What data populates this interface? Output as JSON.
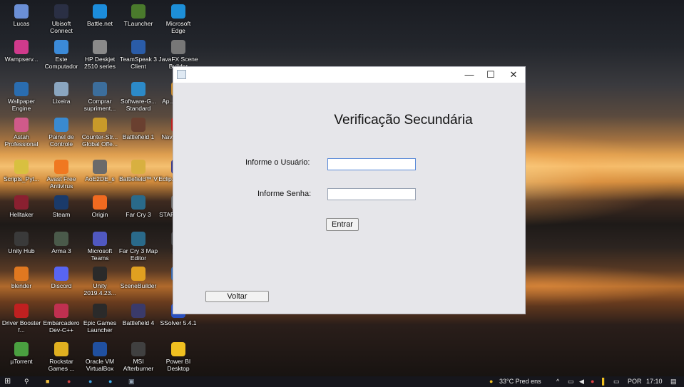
{
  "desktop": {
    "icons": [
      {
        "label": "Lucas",
        "icon": "user-folder-icon",
        "color": "#6b8fd6"
      },
      {
        "label": "Ubisoft Connect",
        "icon": "ubisoft-icon",
        "color": "#2a2f44"
      },
      {
        "label": "Battle.net",
        "icon": "battlenet-icon",
        "color": "#1c8ddc"
      },
      {
        "label": "TLauncher",
        "icon": "tlauncher-icon",
        "color": "#4a7a2c"
      },
      {
        "label": "Microsoft Edge",
        "icon": "edge-icon",
        "color": "#1d8fd8"
      },
      {
        "label": "Wampserv...",
        "icon": "wamp-icon",
        "color": "#d03a8c"
      },
      {
        "label": "Este Computador",
        "icon": "computer-icon",
        "color": "#3b8ad8"
      },
      {
        "label": "HP Deskjet 2510 series",
        "icon": "printer-icon",
        "color": "#8a8a8a"
      },
      {
        "label": "TeamSpeak 3 Client",
        "icon": "teamspeak-icon",
        "color": "#2a5ca8"
      },
      {
        "label": "JavaFX Scene Builder",
        "icon": "scenebuilder-icon",
        "color": "#777777"
      },
      {
        "label": "Wallpaper Engine",
        "icon": "wallpaper-engine-icon",
        "color": "#2a6db0"
      },
      {
        "label": "Lixeira",
        "icon": "recycle-bin-icon",
        "color": "#8aa6c0"
      },
      {
        "label": "Comprar supriment...",
        "icon": "printer-supplies-icon",
        "color": "#3c6e9c"
      },
      {
        "label": "Software-G... Standard",
        "icon": "software-icon",
        "color": "#2c8ac8"
      },
      {
        "label": "Ap... NetB...",
        "icon": "netbeans-icon",
        "color": "#c88a2a"
      },
      {
        "label": "Astah Professional",
        "icon": "astah-icon",
        "color": "#d05a8a"
      },
      {
        "label": "Painel de Controle",
        "icon": "control-panel-icon",
        "color": "#3a8ad0"
      },
      {
        "label": "Counter-Str... Global Offe...",
        "icon": "csgo-icon",
        "color": "#c89a2a"
      },
      {
        "label": "Battlefield 1",
        "icon": "battlefield1-icon",
        "color": "#6a4030"
      },
      {
        "label": "Nav... Ope...",
        "icon": "opera-icon",
        "color": "#c02020"
      },
      {
        "label": "Scripts_Pyt...",
        "icon": "python-file-icon",
        "color": "#d8c040"
      },
      {
        "label": "Avast Free Antivirus",
        "icon": "avast-icon",
        "color": "#f07820"
      },
      {
        "label": "AoE2DE_s",
        "icon": "aoe-icon",
        "color": "#6a6a6a"
      },
      {
        "label": "Battlefield™ V",
        "icon": "battlefield5-icon",
        "color": "#d8b040"
      },
      {
        "label": "Eclip... for Er...",
        "icon": "eclipse-icon",
        "color": "#3a3a8a"
      },
      {
        "label": "Helltaker",
        "icon": "helltaker-icon",
        "color": "#8a2030"
      },
      {
        "label": "Steam",
        "icon": "steam-icon",
        "color": "#1a3a6a"
      },
      {
        "label": "Origin",
        "icon": "origin-icon",
        "color": "#f06a20"
      },
      {
        "label": "Far Cry 3",
        "icon": "farcry3-icon",
        "color": "#2a6a8a"
      },
      {
        "label": "STAR... Squ...",
        "icon": "starwars-icon",
        "color": "#6a6a6a"
      },
      {
        "label": "Unity Hub",
        "icon": "unity-hub-icon",
        "color": "#3a3a3a"
      },
      {
        "label": "Arma 3",
        "icon": "arma3-icon",
        "color": "#4a5a4a"
      },
      {
        "label": "Microsoft Teams",
        "icon": "teams-icon",
        "color": "#5058c0"
      },
      {
        "label": "Far Cry 3 Map Editor",
        "icon": "farcry-editor-icon",
        "color": "#2a6a8a"
      },
      {
        "label": "DEV",
        "icon": "dev-icon",
        "color": "#444444"
      },
      {
        "label": "blender",
        "icon": "blender-icon",
        "color": "#e07820"
      },
      {
        "label": "Discord",
        "icon": "discord-icon",
        "color": "#5865f2"
      },
      {
        "label": "Unity 2019.4.23...",
        "icon": "unity-icon",
        "color": "#2a2a2a"
      },
      {
        "label": "SceneBuilder",
        "icon": "scenebuilder2-icon",
        "color": "#e0a020"
      },
      {
        "label": "R...",
        "icon": "r-icon",
        "color": "#3a6ab0"
      },
      {
        "label": "Driver Booster f...",
        "icon": "driver-booster-icon",
        "color": "#c02020"
      },
      {
        "label": "Embarcadero Dev-C++",
        "icon": "devcpp-icon",
        "color": "#c03050"
      },
      {
        "label": "Epic Games Launcher",
        "icon": "epic-games-icon",
        "color": "#2a2a2a"
      },
      {
        "label": "Battlefield 4",
        "icon": "battlefield4-icon",
        "color": "#3a3a6a"
      },
      {
        "label": "SSolver 5.4.1",
        "icon": "ssolver-icon",
        "color": "#2a50c0"
      },
      {
        "label": "µTorrent",
        "icon": "utorrent-icon",
        "color": "#4aa040"
      },
      {
        "label": "Rockstar Games ...",
        "icon": "rockstar-icon",
        "color": "#e0b020"
      },
      {
        "label": "Oracle VM VirtualBox",
        "icon": "virtualbox-icon",
        "color": "#2050a0"
      },
      {
        "label": "MSI Afterburner",
        "icon": "msi-afterburner-icon",
        "color": "#404040"
      },
      {
        "label": "Power BI Desktop",
        "icon": "powerbi-icon",
        "color": "#f0c020"
      }
    ]
  },
  "window": {
    "title": "",
    "minimize": "—",
    "maximize": "☐",
    "close": "✕",
    "heading": "Verificação Secundária",
    "user_label": "Informe o Usuário:",
    "user_value": "",
    "password_label": "Informe Senha:",
    "password_value": "",
    "enter_button": "Entrar",
    "back_button": "Voltar"
  },
  "taskbar": {
    "weather": "33°C  Pred ens",
    "language": "POR",
    "time": "17:10"
  }
}
